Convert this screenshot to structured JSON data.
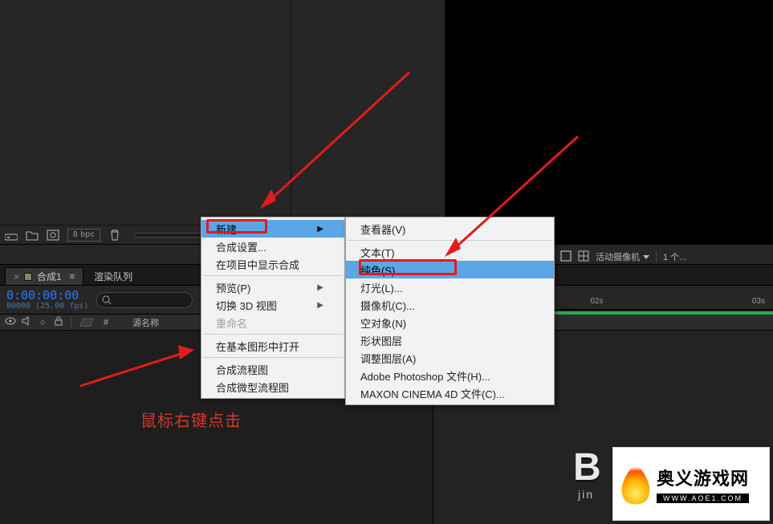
{
  "project_toolbar": {
    "bpc": "8 bpc"
  },
  "view_toolbar": {
    "camera_label": "活动摄像机",
    "view_count": "1 个..."
  },
  "timeline": {
    "tab_active": "合成1",
    "tab_other": "渲染队列",
    "timecode": "0:00:00:00",
    "timecode_sub": "00000 (25.00 fps)",
    "col_hash": "#",
    "col_source": "源名称",
    "ruler": {
      "t1": "02s",
      "t2": "03s"
    }
  },
  "menu1": {
    "items": [
      {
        "label": "新建",
        "has_sub": true,
        "hl": true
      },
      {
        "label": "合成设置...",
        "has_sub": false
      },
      {
        "label": "在项目中显示合成",
        "has_sub": false
      },
      {
        "sep": true
      },
      {
        "label": "预览(P)",
        "has_sub": true
      },
      {
        "label": "切换 3D 视图",
        "has_sub": true
      },
      {
        "label": "重命名",
        "disabled": true
      },
      {
        "sep": true
      },
      {
        "label": "在基本图形中打开",
        "has_sub": false
      },
      {
        "sep": true
      },
      {
        "label": "合成流程图",
        "has_sub": false
      },
      {
        "label": "合成微型流程图",
        "has_sub": false
      }
    ]
  },
  "menu2": {
    "items": [
      {
        "label": "查看器(V)"
      },
      {
        "sep": true
      },
      {
        "label": "文本(T)"
      },
      {
        "label": "纯色(S)...",
        "hl": true
      },
      {
        "label": "灯光(L)..."
      },
      {
        "label": "摄像机(C)..."
      },
      {
        "label": "空对象(N)"
      },
      {
        "label": "形状图层"
      },
      {
        "label": "调整图层(A)"
      },
      {
        "label": "Adobe Photoshop 文件(H)..."
      },
      {
        "label": "MAXON CINEMA 4D 文件(C)..."
      }
    ]
  },
  "hint": "鼠标右键点击",
  "watermark": {
    "title": "奥义游戏网",
    "url": "WWW.AOE1.COM"
  },
  "bj": {
    "big": "B",
    "sub": "jin"
  }
}
